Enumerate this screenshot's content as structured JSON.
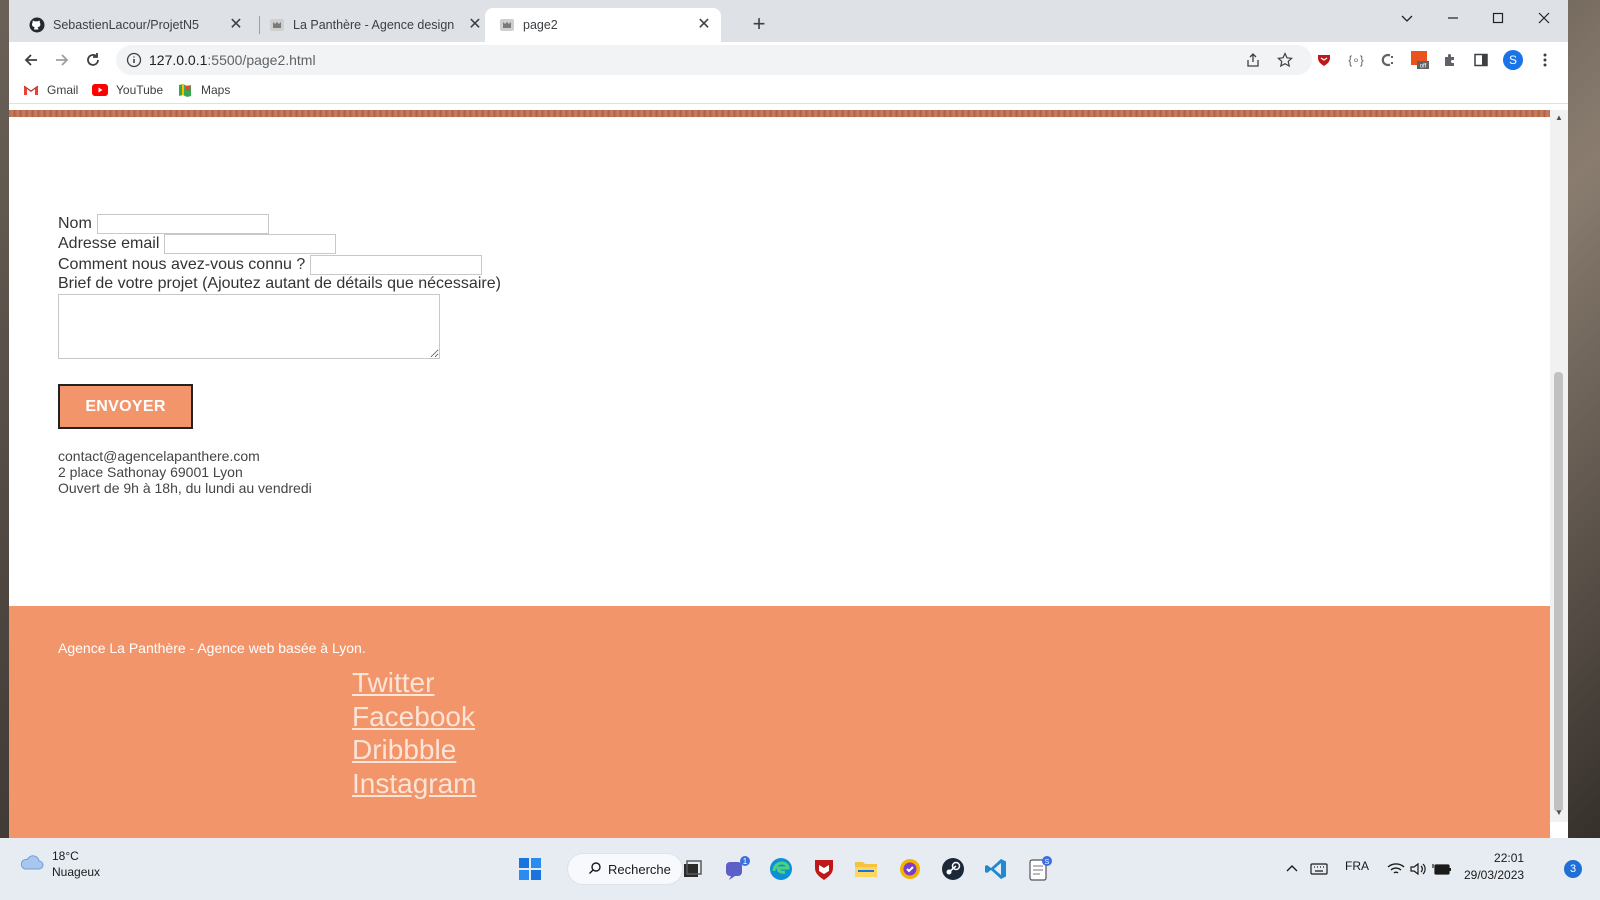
{
  "browser": {
    "tabs": [
      {
        "label": "SebastienLacour/ProjetN5",
        "icon": "github-icon"
      },
      {
        "label": "La Panthère - Agence design",
        "icon": "panther-icon"
      },
      {
        "label": "page2",
        "icon": "panther-icon",
        "active": true
      }
    ],
    "url_host": "127.0.0.1",
    "url_path": ":5500/page2.html",
    "profile_initial": "S",
    "bookmarks": [
      {
        "label": "Gmail",
        "icon": "gmail-icon"
      },
      {
        "label": "YouTube",
        "icon": "youtube-icon"
      },
      {
        "label": "Maps",
        "icon": "maps-icon"
      }
    ]
  },
  "form": {
    "nom_label": "Nom",
    "email_label": "Adresse email",
    "source_label": "Comment nous avez-vous connu ?",
    "brief_label": "Brief de votre projet (Ajoutez autant de détails que nécessaire)",
    "submit_label": "ENVOYER"
  },
  "contact": {
    "email": "contact@agencelapanthere.com",
    "address": "2 place Sathonay 69001 Lyon",
    "hours": "Ouvert de 9h à 18h, du lundi au vendredi"
  },
  "footer": {
    "tagline": "Agence La Panthère - Agence web basée à Lyon.",
    "social": [
      "Twitter",
      "Facebook",
      "Dribbble",
      "Instagram"
    ]
  },
  "taskbar": {
    "temperature": "18°C",
    "weather": "Nuageux",
    "search_label": "Recherche",
    "chat_badge": "1",
    "notepad_badge": "S",
    "language": "FRA",
    "time": "22:01",
    "date": "29/03/2023",
    "notifications": "3"
  },
  "colors": {
    "accent": "#f2956a",
    "banner": "#b86a4d",
    "taskbar": "#e7ecf3"
  }
}
